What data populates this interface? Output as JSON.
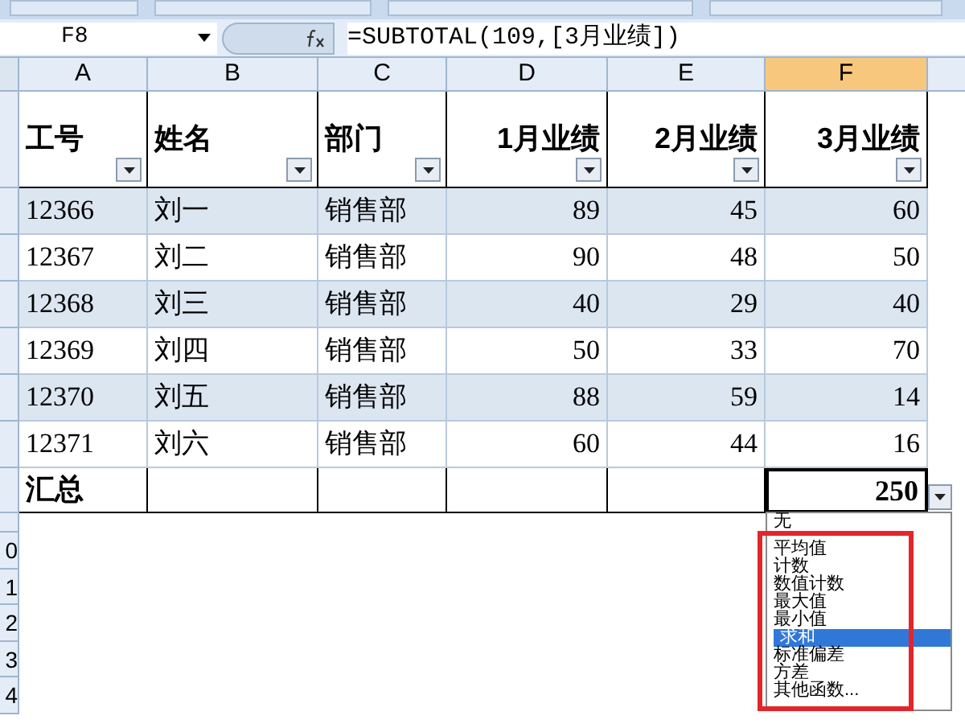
{
  "formula_bar": {
    "name_box": "F8",
    "formula": "=SUBTOTAL(109,[3月业绩])"
  },
  "column_headers": [
    {
      "label": "A",
      "selected": false
    },
    {
      "label": "B",
      "selected": false
    },
    {
      "label": "C",
      "selected": false
    },
    {
      "label": "D",
      "selected": false
    },
    {
      "label": "E",
      "selected": false
    },
    {
      "label": "F",
      "selected": true
    }
  ],
  "table": {
    "columns": [
      {
        "label": "工号",
        "kind": "text"
      },
      {
        "label": "姓名",
        "kind": "text"
      },
      {
        "label": "部门",
        "kind": "text"
      },
      {
        "label": "1月业绩",
        "kind": "number"
      },
      {
        "label": "2月业绩",
        "kind": "number"
      },
      {
        "label": "3月业绩",
        "kind": "number"
      }
    ],
    "rows": [
      [
        "12366",
        "刘一",
        "销售部",
        "89",
        "45",
        "60"
      ],
      [
        "12367",
        "刘二",
        "销售部",
        "90",
        "48",
        "50"
      ],
      [
        "12368",
        "刘三",
        "销售部",
        "40",
        "29",
        "40"
      ],
      [
        "12369",
        "刘四",
        "销售部",
        "50",
        "33",
        "70"
      ],
      [
        "12370",
        "刘五",
        "销售部",
        "88",
        "59",
        "14"
      ],
      [
        "12371",
        "刘六",
        "销售部",
        "60",
        "44",
        "16"
      ]
    ],
    "total_label": "汇总",
    "total_value": "250"
  },
  "row_numbers": [
    "0",
    "1",
    "2",
    "3",
    "4"
  ],
  "total_dropdown": {
    "options": [
      {
        "label": "无",
        "selected": false
      },
      {
        "label": "平均值",
        "selected": false
      },
      {
        "label": "计数",
        "selected": false
      },
      {
        "label": "数值计数",
        "selected": false
      },
      {
        "label": "最大值",
        "selected": false
      },
      {
        "label": "最小值",
        "selected": false
      },
      {
        "label": "求和",
        "selected": true
      },
      {
        "label": "标准偏差",
        "selected": false
      },
      {
        "label": "方差",
        "selected": false
      },
      {
        "label": "其他函数...",
        "selected": false
      }
    ]
  }
}
